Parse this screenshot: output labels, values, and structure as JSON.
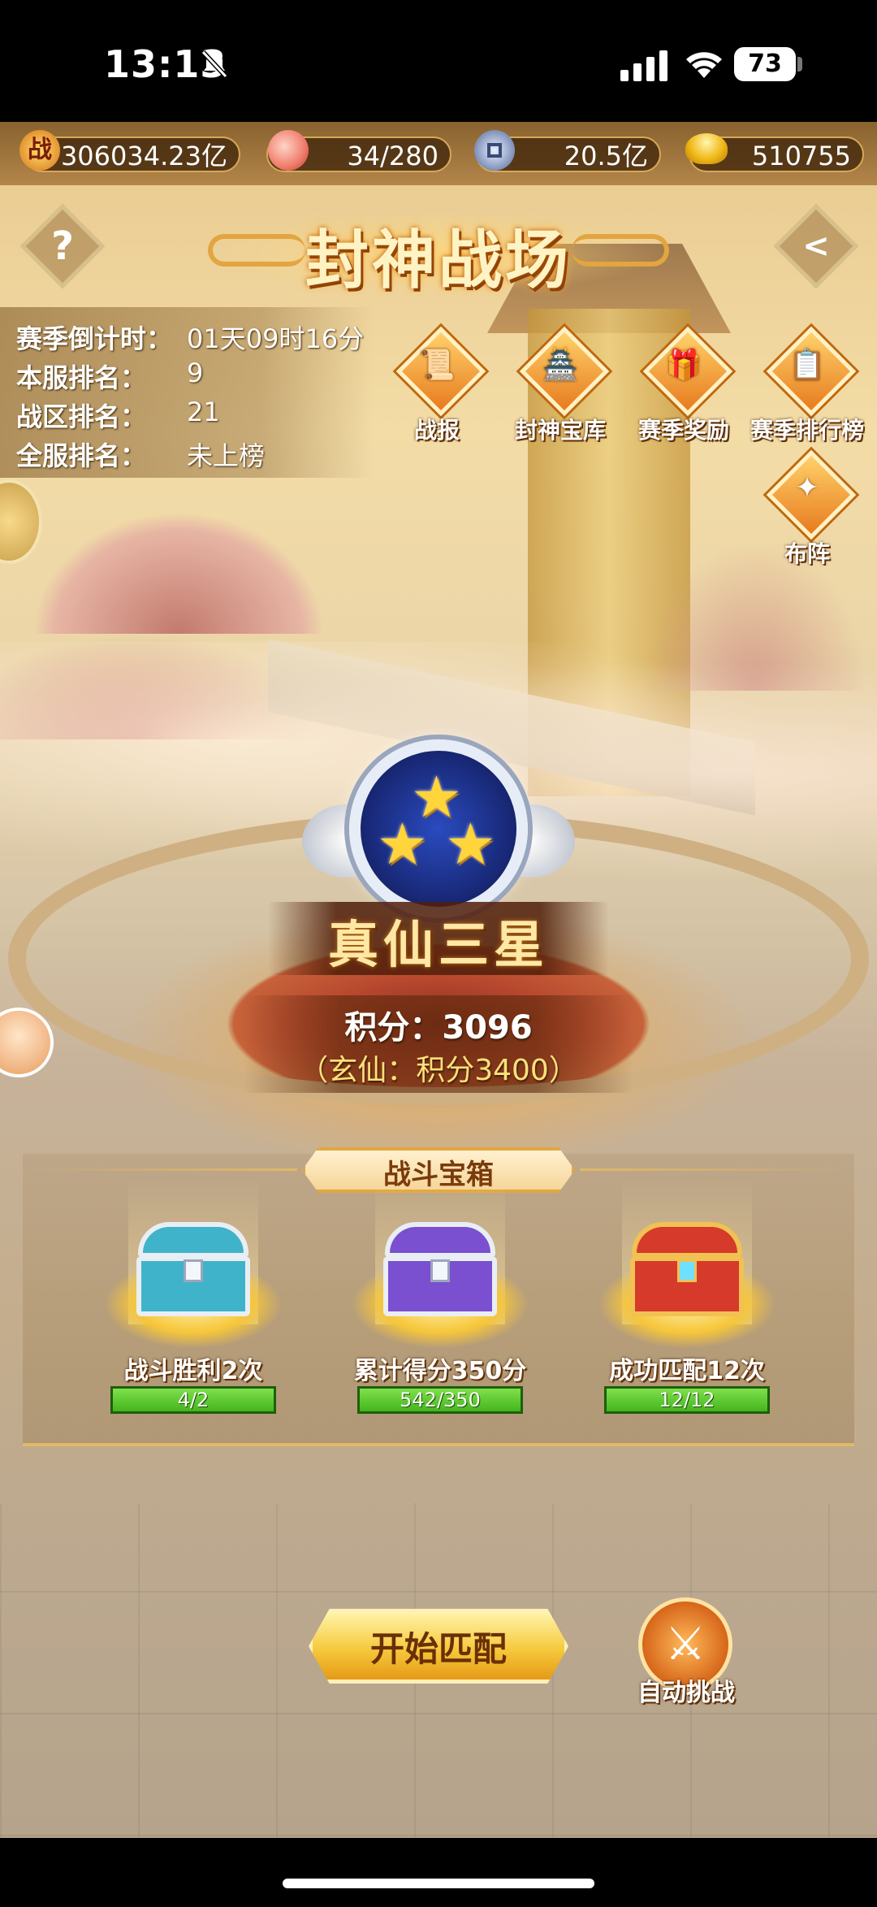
{
  "status_bar": {
    "time": "13:13",
    "battery": "73"
  },
  "currency": {
    "power": "306034.23亿",
    "power_icon_text": "战",
    "peach": "34/280",
    "coin": "20.5亿",
    "gold": "510755"
  },
  "header": {
    "title": "封神战场",
    "help": "?",
    "back": "<"
  },
  "season": {
    "rows": [
      {
        "label": "赛季倒计时：",
        "value": "01天09时16分"
      },
      {
        "label": "本服排名：",
        "value": "9"
      },
      {
        "label": "战区排名：",
        "value": "21"
      },
      {
        "label": "全服排名：",
        "value": "未上榜"
      }
    ]
  },
  "features": [
    {
      "label": "战报",
      "icon": "scroll-icon"
    },
    {
      "label": "封神宝库",
      "icon": "treasury-icon"
    },
    {
      "label": "赛季奖励",
      "icon": "reward-chest-icon"
    },
    {
      "label": "赛季排行榜",
      "icon": "leaderboard-icon"
    },
    {
      "label": "布阵",
      "icon": "formation-icon"
    }
  ],
  "rank": {
    "name": "真仙三星",
    "stars": 3,
    "score_text": "积分：3096",
    "next_text": "（玄仙：积分3400）"
  },
  "chests": {
    "title": "战斗宝箱",
    "items": [
      {
        "label": "战斗胜利2次",
        "progress": "4/2",
        "fill": 1.0,
        "color": "#3fb3c9"
      },
      {
        "label": "累计得分350分",
        "progress": "542/350",
        "fill": 1.0,
        "color": "#7a4fd0"
      },
      {
        "label": "成功匹配12次",
        "progress": "12/12",
        "fill": 1.0,
        "color": "#d63a2a"
      }
    ]
  },
  "actions": {
    "match": "开始匹配",
    "auto": "自动挑战"
  }
}
